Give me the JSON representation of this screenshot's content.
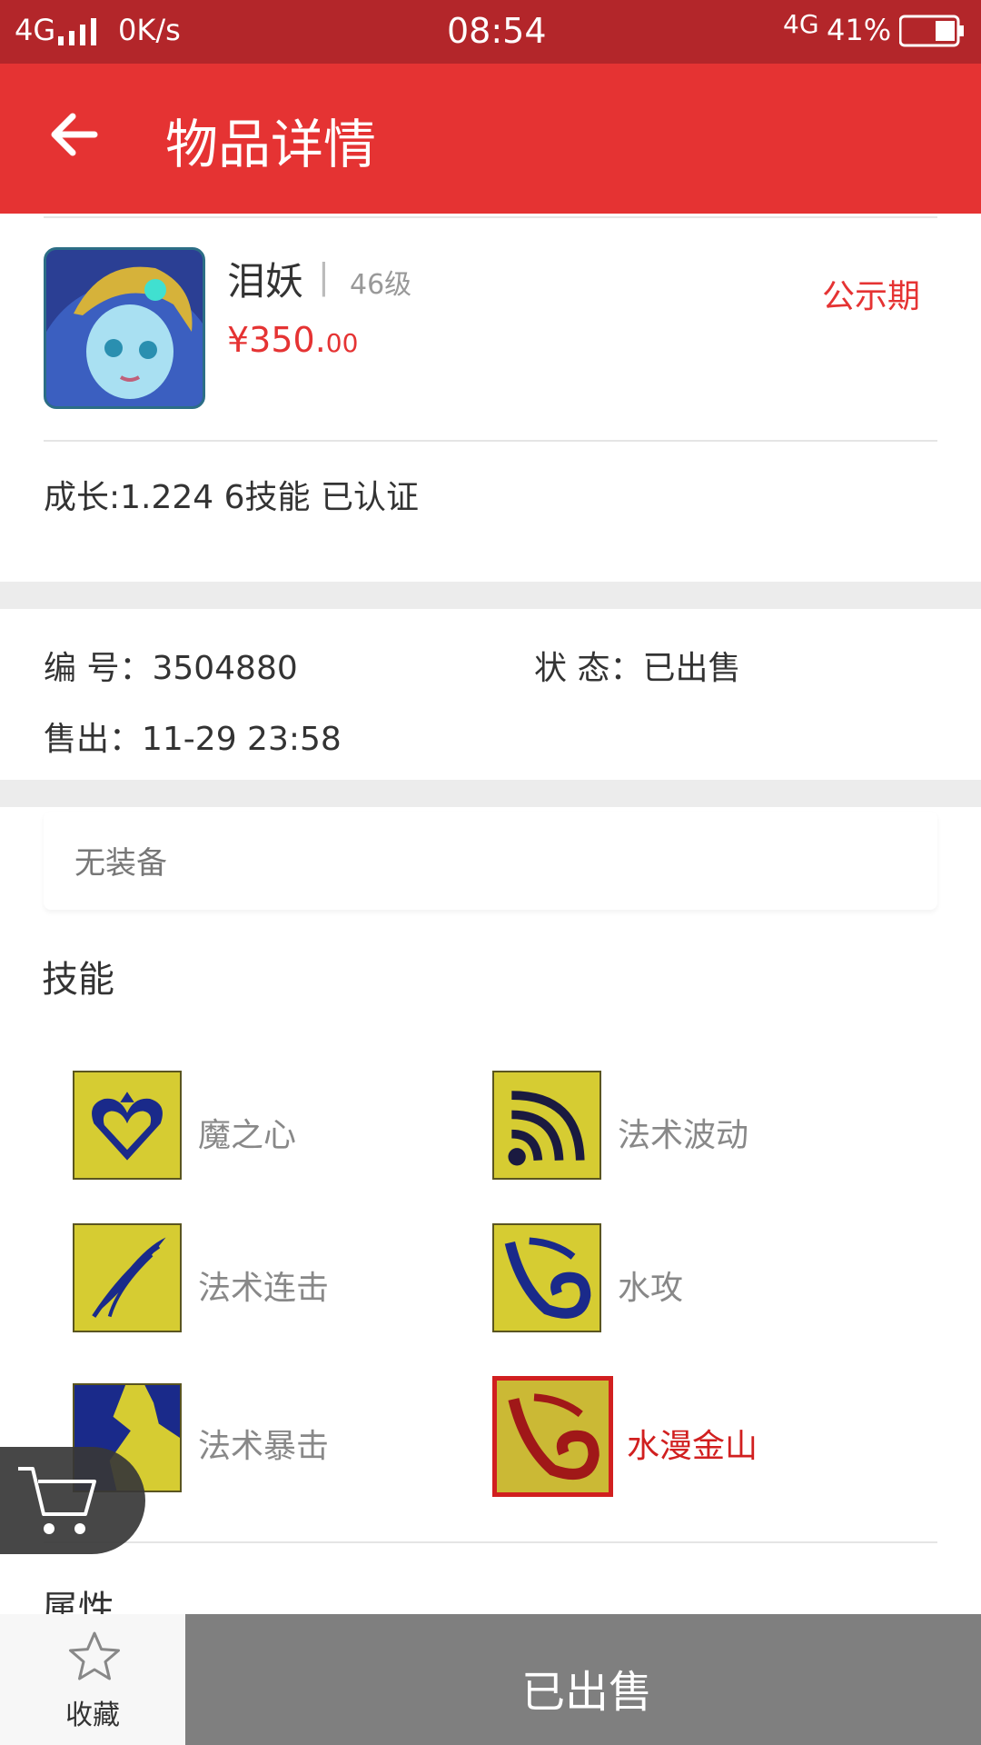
{
  "status_bar": {
    "network_left": "4G",
    "speed": "0K/s",
    "time": "08:54",
    "network_right": "4G",
    "battery": "41%"
  },
  "header": {
    "title": "物品详情",
    "back_icon": "arrow-left-icon"
  },
  "item": {
    "name": "泪妖",
    "separator": "|",
    "level": "46级",
    "price_main": "¥350.",
    "price_decimal": "00",
    "status_tag": "公示期",
    "attributes": "成长:1.224  6技能  已认证"
  },
  "details": {
    "number_label": "编  号：3504880",
    "status_label": "状  态：已出售",
    "sold_label": "售出：11-29 23:58"
  },
  "equipment": {
    "text": "无装备"
  },
  "skills": {
    "title": "技能",
    "items": [
      {
        "name": "魔之心",
        "icon": "heart-icon",
        "highlight": false
      },
      {
        "name": "法术波动",
        "icon": "waves-icon",
        "highlight": false
      },
      {
        "name": "法术连击",
        "icon": "comet-icon",
        "highlight": false
      },
      {
        "name": "水攻",
        "icon": "water-icon",
        "highlight": false
      },
      {
        "name": "法术暴击",
        "icon": "crack-icon",
        "highlight": false
      },
      {
        "name": "水漫金山",
        "icon": "flood-icon",
        "highlight": true
      }
    ]
  },
  "properties": {
    "title": "属性"
  },
  "bottom_bar": {
    "favorite_label": "收藏",
    "sold_label": "已出售"
  },
  "colors": {
    "primary": "#e53333",
    "statusbar": "#b3262a",
    "sold_button": "#7f7f7f"
  }
}
